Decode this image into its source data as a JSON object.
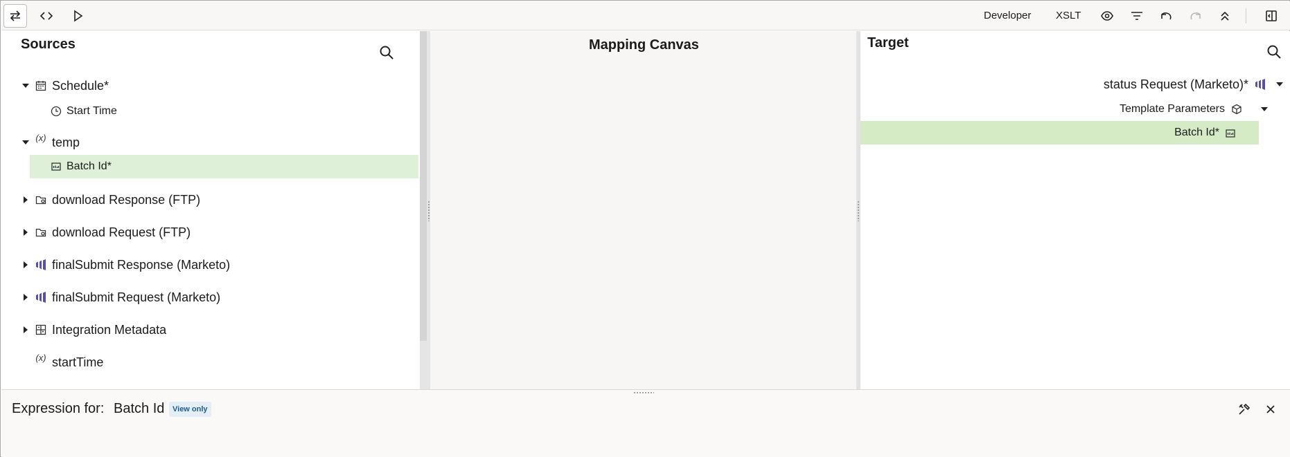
{
  "toolbar": {
    "developer_label": "Developer",
    "xslt_label": "XSLT",
    "icons": [
      "swap-icon",
      "code-icon",
      "play-icon",
      "eye-icon",
      "filter-icon",
      "undo-icon",
      "redo-icon",
      "collapse-all-icon",
      "toggle-panel-icon"
    ]
  },
  "sources": {
    "title": "Sources",
    "items": [
      {
        "label": "Schedule*",
        "icon": "calendar-icon",
        "expanded": true
      },
      {
        "label": "Start Time",
        "icon": "clock-icon"
      },
      {
        "label": "temp",
        "icon": "variable-icon",
        "expanded": true
      },
      {
        "label": "Batch Id*",
        "icon": "string-field-icon",
        "selected": true
      },
      {
        "label": "download Response (FTP)",
        "icon": "ftp-folder-icon"
      },
      {
        "label": "download Request (FTP)",
        "icon": "ftp-folder-icon"
      },
      {
        "label": "finalSubmit Response (Marketo)",
        "icon": "marketo-icon"
      },
      {
        "label": "finalSubmit Request (Marketo)",
        "icon": "marketo-icon"
      },
      {
        "label": "Integration Metadata",
        "icon": "metadata-icon"
      },
      {
        "label": "startTime",
        "icon": "variable-icon"
      }
    ],
    "variable_glyph": "(x)"
  },
  "canvas": {
    "title": "Mapping Canvas"
  },
  "target": {
    "title": "Target",
    "items": [
      {
        "label": "status Request (Marketo)*",
        "icon": "marketo-icon"
      },
      {
        "label": "Template Parameters",
        "icon": "cube-icon"
      },
      {
        "label": "Batch Id*",
        "icon": "string-field-icon",
        "selected": true
      }
    ]
  },
  "expression": {
    "label": "Expression for:",
    "value": "Batch Id",
    "badge": "View only"
  },
  "colors": {
    "selected_source_row": "#dff0d8",
    "selected_target_row": "#d4ebc6",
    "marketo_purple": "#5b4fa3",
    "badge_bg": "#e3eef7",
    "badge_text": "#1d5b8f"
  }
}
